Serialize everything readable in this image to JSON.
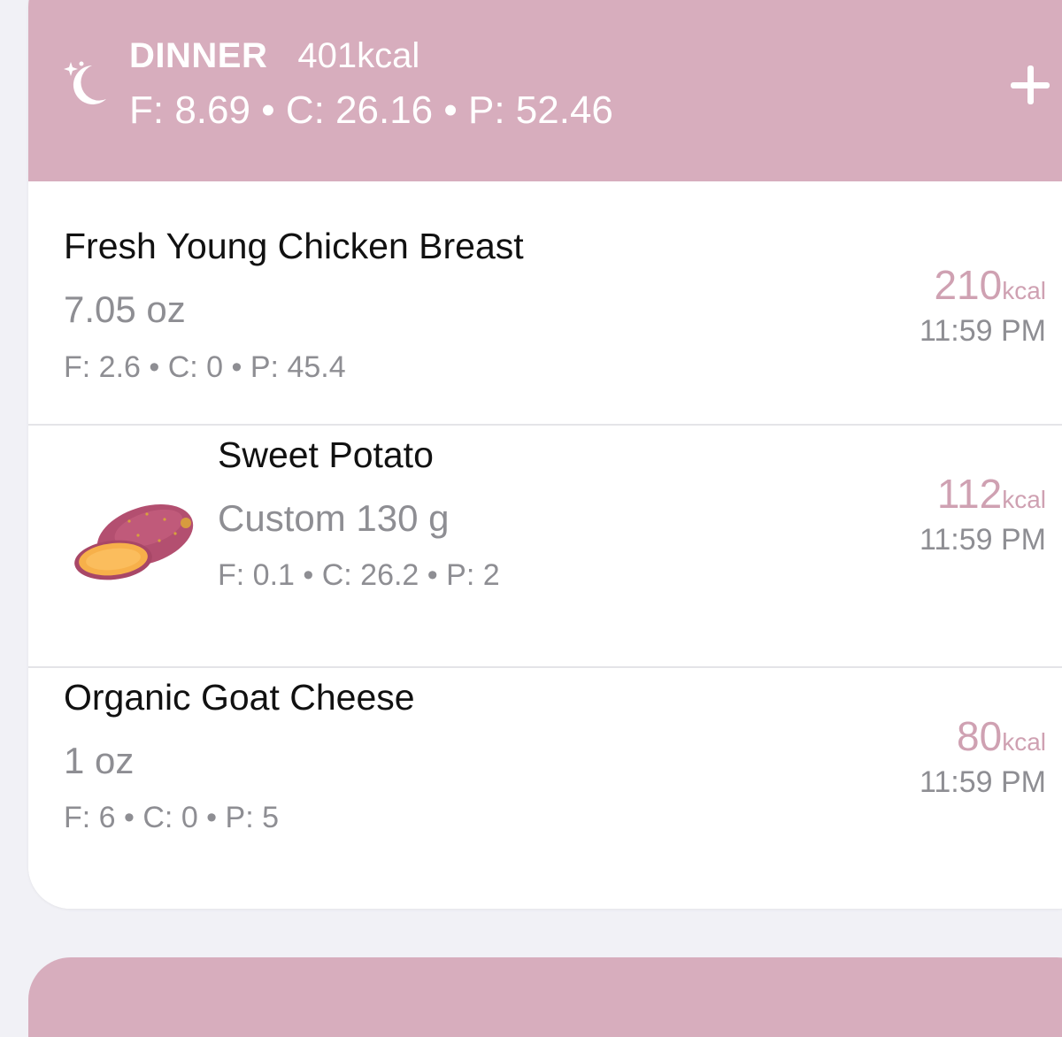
{
  "meal": {
    "name": "DINNER",
    "kcal": "401kcal",
    "macros": "F: 8.69 • C: 26.16 • P: 52.46",
    "icon": "moon-stars-icon",
    "add_icon": "plus-icon",
    "accent_color": "#d7adbd"
  },
  "items": [
    {
      "name": "Fresh Young Chicken Breast",
      "serving": "7.05 oz",
      "macros": "F: 2.6 • C: 0 • P: 45.4",
      "kcal": "210",
      "kcal_unit": "kcal",
      "time": "11:59 PM"
    },
    {
      "name": "Sweet Potato",
      "serving": "Custom 130 g",
      "macros": "F: 0.1 • C: 26.2 • P: 2",
      "kcal": "112",
      "kcal_unit": "kcal",
      "time": "11:59 PM",
      "thumbnail": "sweet-potato-image"
    },
    {
      "name": "Organic Goat Cheese",
      "serving": "1 oz",
      "macros": "F: 6 • C: 0 • P: 5",
      "kcal": "80",
      "kcal_unit": "kcal",
      "time": "11:59 PM"
    }
  ]
}
